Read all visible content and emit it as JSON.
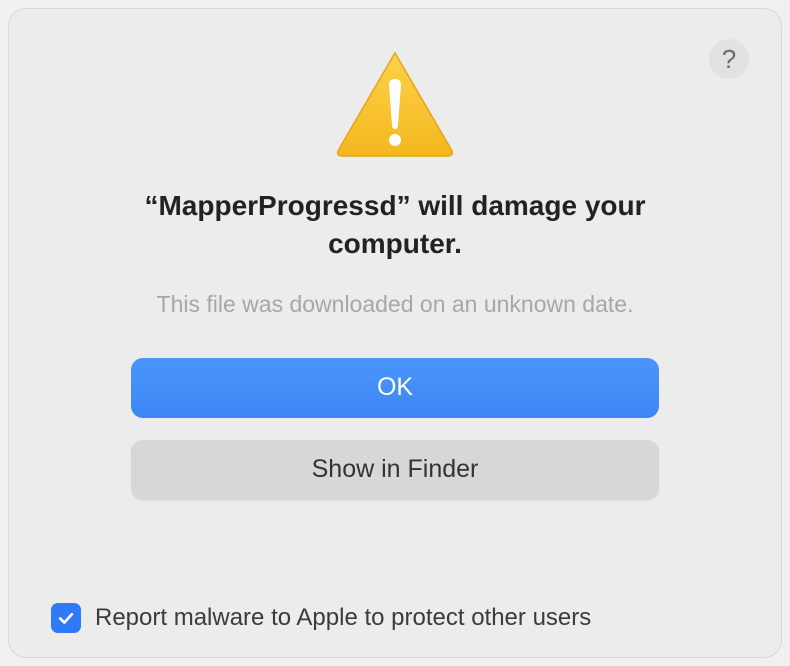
{
  "dialog": {
    "title_prefix": "“",
    "app_name": "MapperProgressd",
    "title_suffix": "” will damage your computer.",
    "subtitle": "This file was downloaded on an unknown date.",
    "help_symbol": "?",
    "primary_button": "OK",
    "secondary_button": "Show in Finder",
    "checkbox_label": "Report malware to Apple to protect other users",
    "checkbox_checked": true
  }
}
